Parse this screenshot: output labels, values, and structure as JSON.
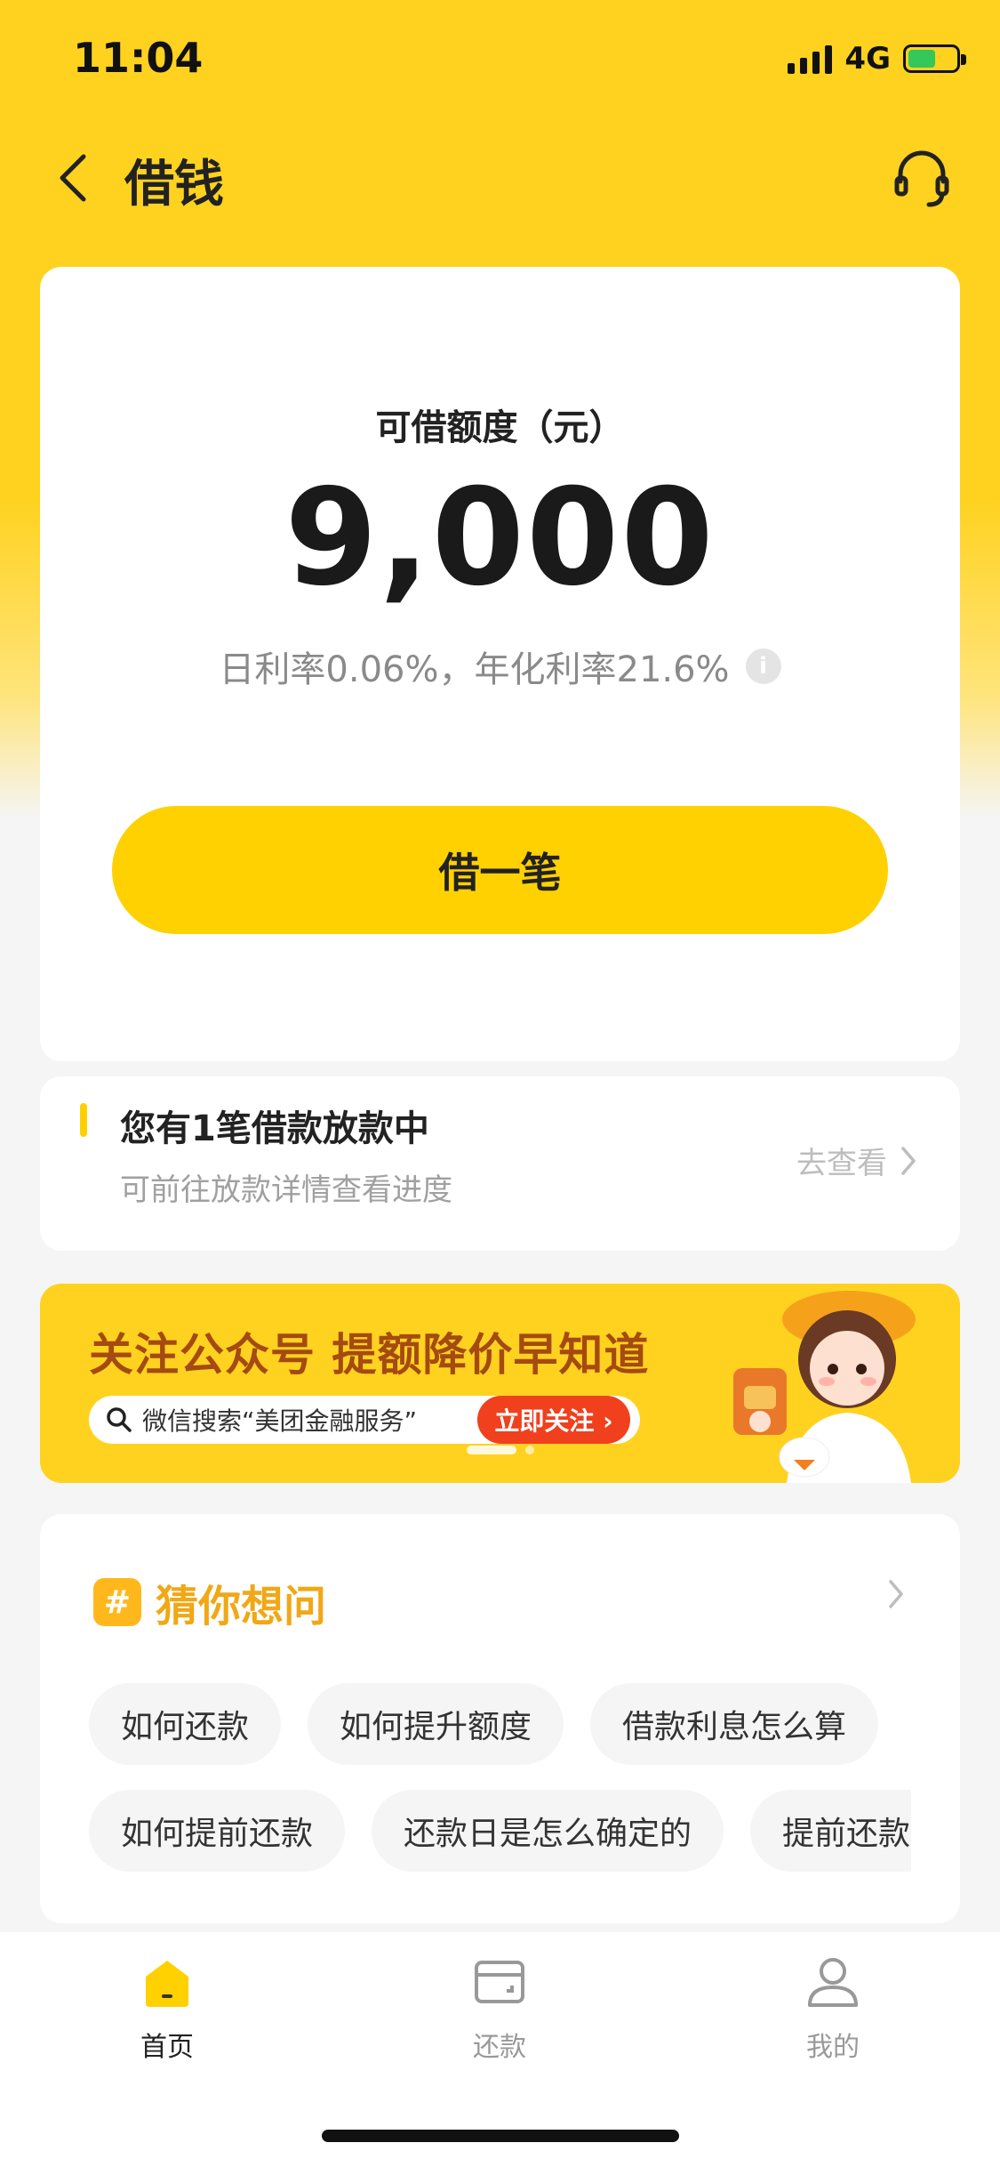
{
  "status_bar": {
    "time": "11:04",
    "network": "4G"
  },
  "nav": {
    "title": "借钱"
  },
  "credit": {
    "label": "可借额度（元）",
    "amount": "9,000",
    "rate": "日利率0.06%，年化利率21.6%",
    "borrow_button": "借一笔"
  },
  "loan_notice": {
    "title": "您有1笔借款放款中",
    "subtitle": "可前往放款详情查看进度",
    "link": "去查看"
  },
  "banner": {
    "title": "关注公众号 提额降价早知道",
    "search_text": "微信搜索“美团金融服务”",
    "follow_button": "立即关注 ›"
  },
  "faq": {
    "title": "猜你想问",
    "row1": [
      "如何还款",
      "如何提升额度",
      "借款利息怎么算"
    ],
    "row2": [
      "如何提前还款",
      "还款日是怎么确定的",
      "提前还款利"
    ]
  },
  "tabs": [
    {
      "label": "首页",
      "icon": "home-icon",
      "active": true
    },
    {
      "label": "还款",
      "icon": "wallet-icon",
      "active": false
    },
    {
      "label": "我的",
      "icon": "profile-icon",
      "active": false
    }
  ],
  "colors": {
    "brand_yellow": "#ffd100",
    "banner_red": "#f0401e",
    "faq_orange": "#f0a816"
  }
}
